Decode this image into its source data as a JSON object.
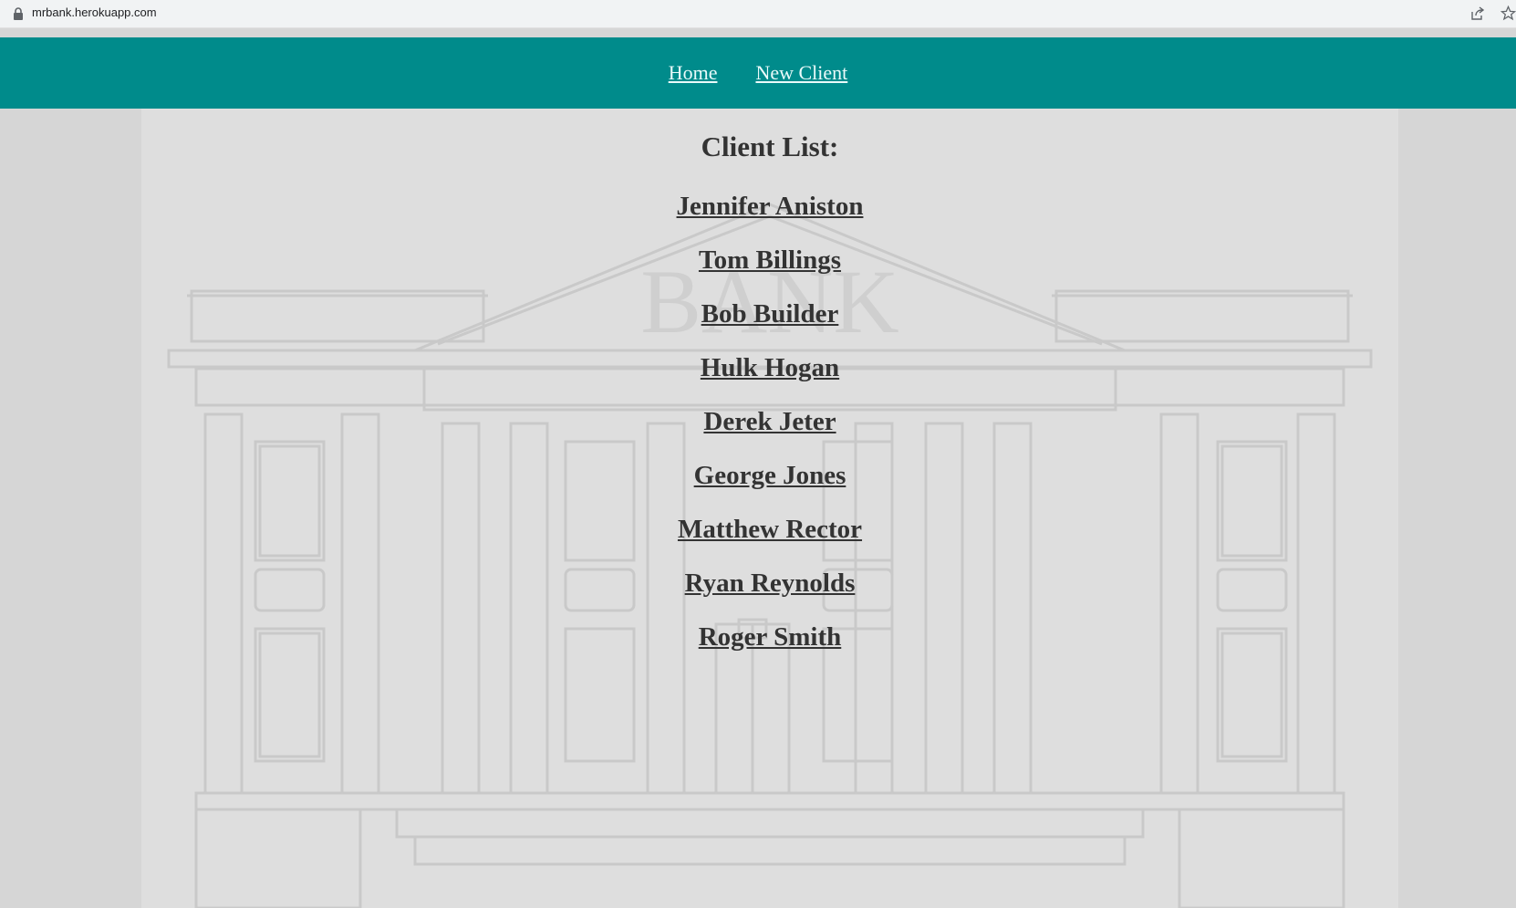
{
  "browser": {
    "url": "mrbank.herokuapp.com"
  },
  "nav": {
    "home_label": "Home",
    "new_client_label": "New Client"
  },
  "page": {
    "title": "Client List:",
    "background_word": "BANK"
  },
  "clients": [
    "Jennifer Aniston",
    "Tom Billings",
    "Bob Builder",
    "Hulk Hogan",
    "Derek Jeter",
    "George Jones",
    "Matthew Rector",
    "Ryan Reynolds",
    "Roger Smith"
  ],
  "colors": {
    "navbar": "#008b8b",
    "content_bg": "#dedede",
    "text": "#333333"
  }
}
